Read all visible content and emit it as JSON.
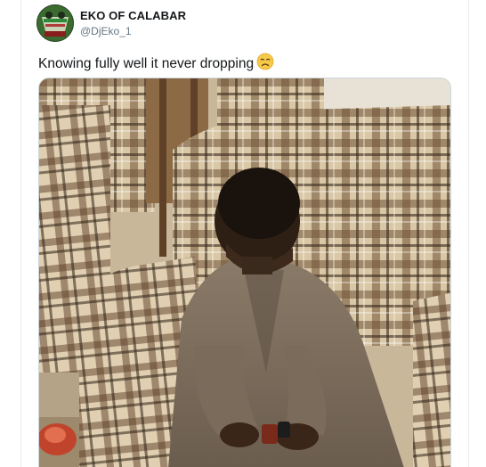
{
  "tweet": {
    "display_name": "EKO OF CALABAR",
    "handle": "@DjEko_1",
    "text": "Knowing fully well it never dropping",
    "emoji": "disappointed-face-emoji"
  },
  "media": {
    "type": "photo"
  },
  "colors": {
    "name": "#14171a",
    "handle": "#657786",
    "border": "#e6ecf0",
    "emoji": "#f7c948"
  }
}
